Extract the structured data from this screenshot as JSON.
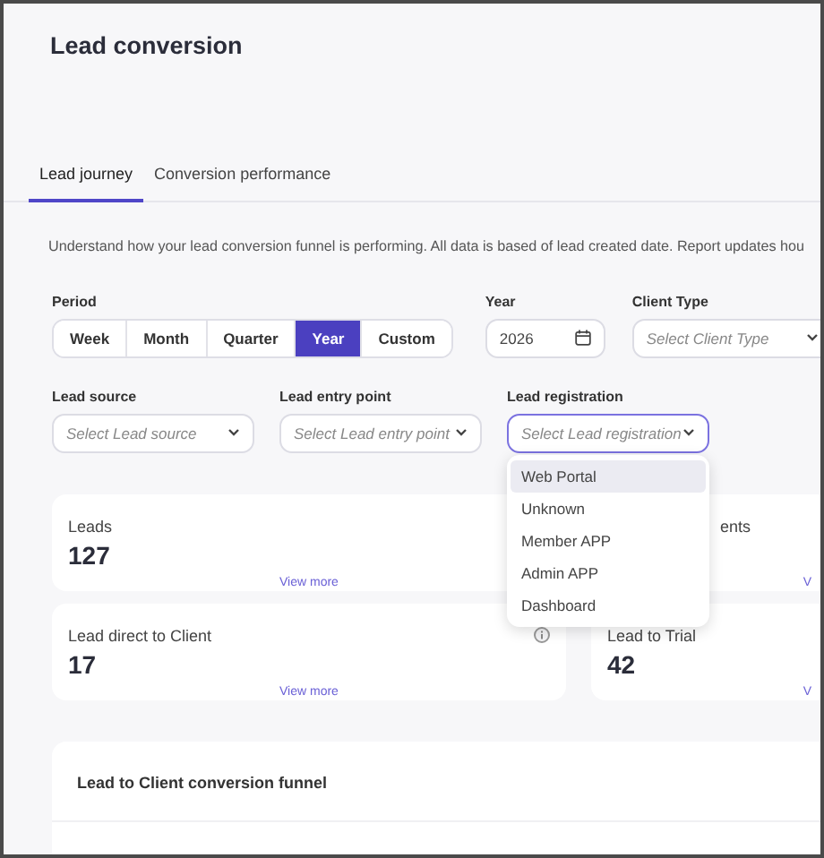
{
  "title": "Lead conversion",
  "tabs": [
    {
      "label": "Lead journey",
      "selected": true
    },
    {
      "label": "Conversion performance",
      "selected": false
    }
  ],
  "description": "Understand how your lead conversion funnel is performing. All data is based of lead created date. Report updates hou",
  "period": {
    "label": "Period",
    "options": [
      {
        "label": "Week",
        "selected": false
      },
      {
        "label": "Month",
        "selected": false
      },
      {
        "label": "Quarter",
        "selected": false
      },
      {
        "label": "Year",
        "selected": true
      },
      {
        "label": "Custom",
        "selected": false
      }
    ]
  },
  "year": {
    "label": "Year",
    "value": "2026"
  },
  "client_type": {
    "label": "Client Type",
    "placeholder": "Select Client Type"
  },
  "selects": [
    {
      "label": "Lead source",
      "placeholder": "Select Lead source",
      "expanded": false
    },
    {
      "label": "Lead entry point",
      "placeholder": "Select Lead entry point",
      "expanded": false
    },
    {
      "label": "Lead registration",
      "placeholder": "Select Lead registration",
      "expanded": true,
      "options": [
        {
          "label": "Web Portal",
          "selected": true
        },
        {
          "label": "Unknown",
          "selected": false
        },
        {
          "label": "Member APP",
          "selected": false
        },
        {
          "label": "Admin APP",
          "selected": false
        },
        {
          "label": "Dashboard",
          "selected": false
        }
      ]
    }
  ],
  "cards": [
    {
      "title": "Leads",
      "value": "127",
      "link": "View more",
      "info": false
    },
    {
      "title": "ents",
      "link": "V",
      "info": false
    },
    {
      "title": "Lead direct to Client",
      "value": "17",
      "link": "View more",
      "info": true
    },
    {
      "title": "Lead to Trial",
      "value": "42",
      "link": "V",
      "info": false
    }
  ],
  "funnel": {
    "title": "Lead to Client conversion funnel"
  }
}
